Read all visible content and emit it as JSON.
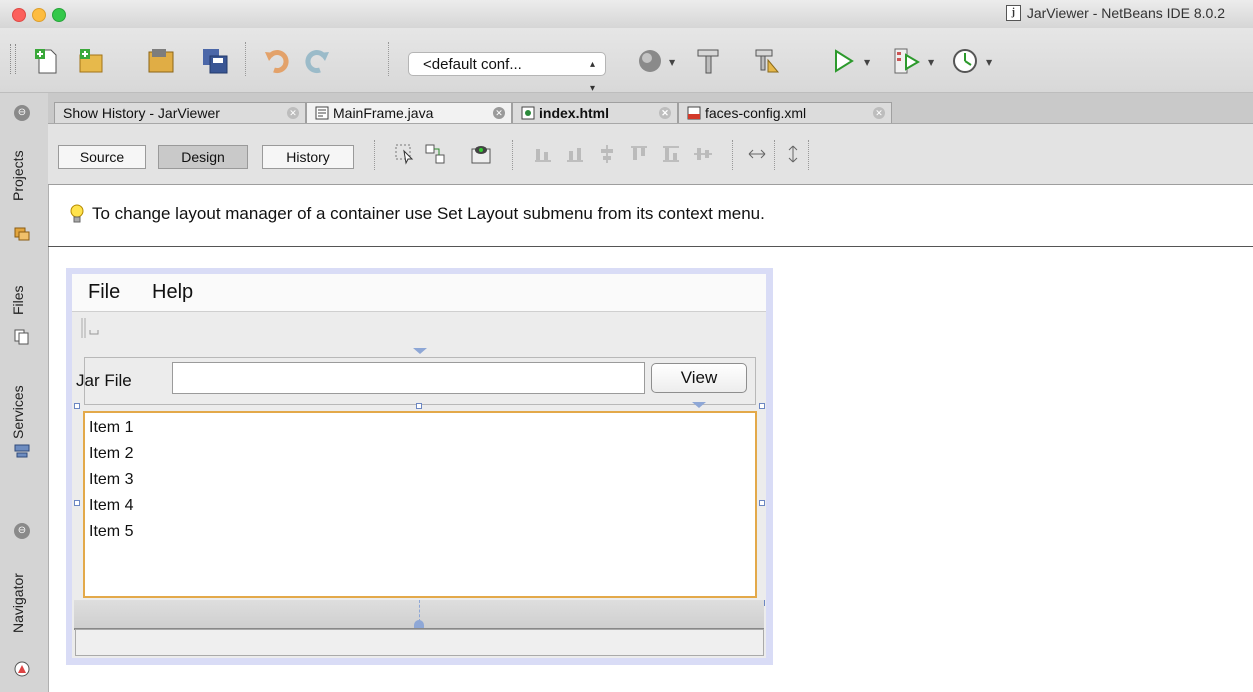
{
  "window": {
    "title": "JarViewer - NetBeans IDE 8.0.2"
  },
  "toolbar": {
    "config_select_value": "<default conf...",
    "icons": [
      "new-file-icon",
      "new-project-icon",
      "open-project-icon",
      "save-all-icon",
      "undo-icon",
      "redo-icon",
      "globe-icon",
      "build-hammer-icon",
      "clean-build-icon",
      "run-icon",
      "debug-icon",
      "profile-icon"
    ]
  },
  "left_strip": {
    "tabs": [
      {
        "label": "Projects"
      },
      {
        "label": "Files"
      },
      {
        "label": "Services"
      },
      {
        "label": "Navigator"
      }
    ]
  },
  "editor_tabs": [
    {
      "label": "Show History - JarViewer",
      "active": false
    },
    {
      "label": "MainFrame.java",
      "active": true
    },
    {
      "label": "index.html",
      "active": false
    },
    {
      "label": "faces-config.xml",
      "active": false
    }
  ],
  "design_toolbar": {
    "source_label": "Source",
    "design_label": "Design",
    "history_label": "History"
  },
  "hint": {
    "text": "To change layout manager of a container use Set Layout submenu from its context menu."
  },
  "form": {
    "menus": [
      "File",
      "Help"
    ],
    "jar_label": "Jar File",
    "jar_value": "",
    "view_button": "View",
    "list_items": [
      "Item 1",
      "Item 2",
      "Item 3",
      "Item 4",
      "Item 5"
    ]
  },
  "colors": {
    "selection_border": "#e3a94a",
    "form_frame": "#d9dcf6",
    "close_red": "#fc605c",
    "minimize_yellow": "#fdbc40",
    "maximize_green": "#34c84a"
  }
}
